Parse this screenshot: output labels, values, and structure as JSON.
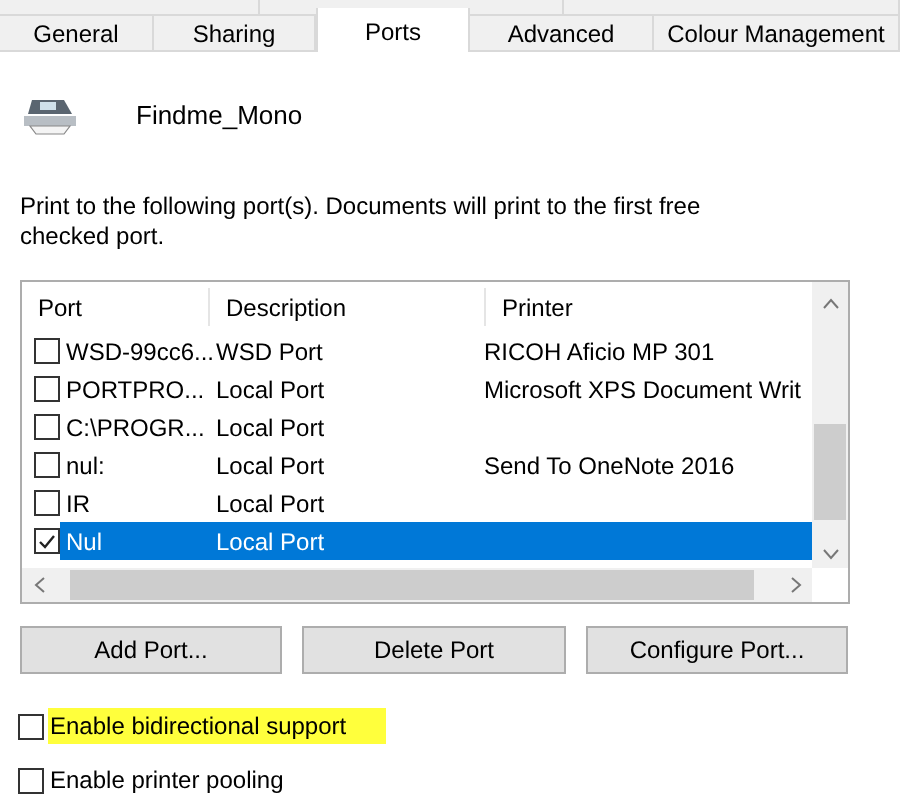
{
  "tabs": [
    {
      "label": "General",
      "selected": false
    },
    {
      "label": "Sharing",
      "selected": false
    },
    {
      "label": "Ports",
      "selected": true
    },
    {
      "label": "Advanced",
      "selected": false
    },
    {
      "label": "Colour Management",
      "selected": false
    }
  ],
  "printer_name": "Findme_Mono",
  "instructions": "Print to the following port(s). Documents will print to the first free checked port.",
  "ports_table": {
    "columns": [
      "Port",
      "Description",
      "Printer"
    ],
    "rows": [
      {
        "port": "WSD-99cc6...",
        "description": "WSD Port",
        "printer": "RICOH Aficio MP 301",
        "checked": false,
        "selected": false
      },
      {
        "port": "PORTPRO...",
        "description": "Local Port",
        "printer": "Microsoft XPS Document Writ",
        "checked": false,
        "selected": false
      },
      {
        "port": "C:\\PROGR...",
        "description": "Local Port",
        "checked": false,
        "selected": false
      },
      {
        "port": "nul:",
        "description": "Local Port",
        "printer": "Send To OneNote 2016",
        "checked": false,
        "selected": false
      },
      {
        "port": "IR",
        "description": "Local Port",
        "checked": false,
        "selected": false
      },
      {
        "port": "Nul",
        "description": "Local Port",
        "checked": true,
        "selected": true
      }
    ]
  },
  "buttons": [
    "Add Port...",
    "Delete Port",
    "Configure Port..."
  ],
  "options": [
    {
      "label": "Enable bidirectional support",
      "checked": false,
      "highlighted": true
    },
    {
      "label": "Enable printer pooling",
      "checked": false,
      "highlighted": false
    }
  ]
}
